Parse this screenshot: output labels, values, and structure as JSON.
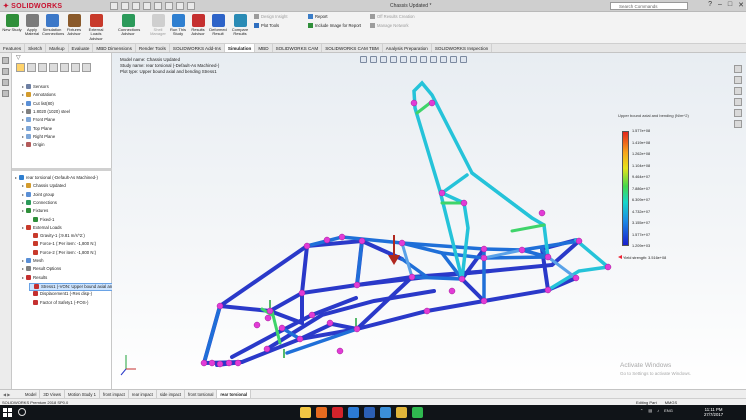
{
  "app": {
    "brand": "SOLIDWORKS",
    "document_title": "Chassis Updated *",
    "search_placeholder": "Search Commands"
  },
  "ribbon": {
    "big_buttons": [
      {
        "label": "New Study",
        "color": "#2f8f3a",
        "dim": false
      },
      {
        "label": "Apply Material",
        "color": "#7b7b7b",
        "dim": false
      },
      {
        "label": "Simulation Connections",
        "color": "#3c78c8",
        "dim": false
      },
      {
        "label": "Fixtures Advisor",
        "color": "#8a5a2b",
        "dim": false
      },
      {
        "label": "External Loads Advisor",
        "color": "#c83a2b",
        "dim": false
      },
      {
        "label": "Connections Advisor",
        "color": "#2b9a5a",
        "dim": false
      },
      {
        "label": "Shell Manager",
        "color": "#7b7b7b",
        "dim": true
      },
      {
        "label": "Run This Study",
        "color": "#2f7fd0",
        "dim": false
      },
      {
        "label": "Results Advisor",
        "color": "#c53030",
        "dim": false
      },
      {
        "label": "Deformed Result",
        "color": "#2d63c8",
        "dim": false
      },
      {
        "label": "Compare Results",
        "color": "#2a8bb5",
        "dim": false
      }
    ],
    "small_buttons": [
      {
        "label": "Design Insight",
        "color": "#9c9c9c",
        "dim": true
      },
      {
        "label": "Plot Tools",
        "color": "#2f6fc0",
        "dim": false
      },
      {
        "label": "Report",
        "color": "#3c7ec8",
        "dim": false
      },
      {
        "label": "Include Image for Report",
        "color": "#2f8f3a",
        "dim": false
      },
      {
        "label": "Off Results Creation",
        "color": "#9c9c9c",
        "dim": true
      },
      {
        "label": "Manage Network",
        "color": "#9c9c9c",
        "dim": true
      }
    ]
  },
  "tabs": [
    {
      "label": "Features",
      "active": false
    },
    {
      "label": "Sketch",
      "active": false
    },
    {
      "label": "Markup",
      "active": false
    },
    {
      "label": "Evaluate",
      "active": false
    },
    {
      "label": "MBD Dimensions",
      "active": false
    },
    {
      "label": "Render Tools",
      "active": false
    },
    {
      "label": "SOLIDWORKS Add-Ins",
      "active": false
    },
    {
      "label": "Simulation",
      "active": true
    },
    {
      "label": "MBD",
      "active": false
    },
    {
      "label": "SOLIDWORKS CAM",
      "active": false
    },
    {
      "label": "SOLIDWORKS CAM TBM",
      "active": false
    },
    {
      "label": "Analysis Preparation",
      "active": false
    },
    {
      "label": "SOLIDWORKS Inspection",
      "active": false
    }
  ],
  "tree": {
    "upper": [
      {
        "label": "Sensors",
        "icon_color": "#6d7fa3",
        "indent": 1
      },
      {
        "label": "Annotations",
        "icon_color": "#d39b2c",
        "indent": 1
      },
      {
        "label": "Cut list(80)",
        "icon_color": "#5a8fd6",
        "indent": 1
      },
      {
        "label": "1.8020 (1020) steel",
        "icon_color": "#7f7f7f",
        "indent": 1
      },
      {
        "label": "Front Plane",
        "icon_color": "#7da6d8",
        "indent": 1
      },
      {
        "label": "Top Plane",
        "icon_color": "#7da6d8",
        "indent": 1
      },
      {
        "label": "Right Plane",
        "icon_color": "#7da6d8",
        "indent": 1
      },
      {
        "label": "Origin",
        "icon_color": "#b35a5a",
        "indent": 1
      }
    ],
    "lower": [
      {
        "label": "rear torsional (-Default-As Machined-)",
        "icon_color": "#2f7fd0",
        "indent": 0,
        "selected": false
      },
      {
        "label": "Chassis Updated",
        "icon_color": "#d39b2c",
        "indent": 1,
        "selected": false
      },
      {
        "label": "Joint group",
        "icon_color": "#5a8fd6",
        "indent": 1,
        "selected": false
      },
      {
        "label": "Connections",
        "icon_color": "#2b9a5a",
        "indent": 1,
        "selected": false
      },
      {
        "label": "Fixtures",
        "icon_color": "#2f8f3a",
        "indent": 1,
        "selected": false
      },
      {
        "label": "Fixed-1",
        "icon_color": "#2f8f3a",
        "indent": 2,
        "selected": false
      },
      {
        "label": "External Loads",
        "icon_color": "#c83a2b",
        "indent": 1,
        "selected": false
      },
      {
        "label": "Gravity-1 (:9.81 m/s^2:)",
        "icon_color": "#c83a2b",
        "indent": 2,
        "selected": false
      },
      {
        "label": "Force-1 (:Per item: -1,800 N:)",
        "icon_color": "#c83a2b",
        "indent": 2,
        "selected": false
      },
      {
        "label": "Force-2 (:Per item: -1,800 N:)",
        "icon_color": "#c83a2b",
        "indent": 2,
        "selected": false
      },
      {
        "label": "Mesh",
        "icon_color": "#5a8fd6",
        "indent": 1,
        "selected": false
      },
      {
        "label": "Result Options",
        "icon_color": "#7f7f7f",
        "indent": 1,
        "selected": false
      },
      {
        "label": "Results",
        "icon_color": "#c53030",
        "indent": 1,
        "selected": false
      },
      {
        "label": "Stress1 (-VON: Upper bound axial and bending-)",
        "icon_color": "#c53030",
        "indent": 2,
        "selected": true
      },
      {
        "label": "Displacement1 (-Res disp-)",
        "icon_color": "#c53030",
        "indent": 2,
        "selected": false
      },
      {
        "label": "Factor of Safety1 (-FOS-)",
        "icon_color": "#c53030",
        "indent": 2,
        "selected": false
      }
    ]
  },
  "graphics": {
    "info_lines": [
      "Model name: Chassis Updated",
      "Study name: rear torsional (-Default-As Machined-)",
      "Plot type: Upper bound axial and bending Stress1"
    ],
    "legend_title": "Upper bound axial and bending (N/m^2)",
    "legend_ticks": [
      "1.577e+08",
      "1.419e+08",
      "1.262e+08",
      "1.104e+08",
      "9.464e+07",
      "7.886e+07",
      "6.309e+07",
      "4.732e+07",
      "3.155e+07",
      "1.577e+07",
      "1.209e+03"
    ],
    "yield_label": "Yield strength: 3.516e+08",
    "watermark": "Activate Windows",
    "watermark_sub": "Go to Settings to activate Windows."
  },
  "bottom_tabs": [
    {
      "label": "Model",
      "active": false
    },
    {
      "label": "3D Views",
      "active": false
    },
    {
      "label": "Motion Study 1",
      "active": false
    },
    {
      "label": "front impact",
      "active": false
    },
    {
      "label": "rear impact",
      "active": false
    },
    {
      "label": "side impact",
      "active": false
    },
    {
      "label": "front torsional",
      "active": false
    },
    {
      "label": "rear torsional",
      "active": true
    }
  ],
  "status": {
    "left": "SOLIDWORKS Premium 2018 SP0.0",
    "right_1": "Editing Part",
    "right_2": "MMGS"
  },
  "taskbar": {
    "apps": [
      {
        "name": "explorer-app",
        "color": "#f2c744"
      },
      {
        "name": "firefox-app",
        "color": "#e66b1f"
      },
      {
        "name": "solidworks-app",
        "color": "#d4232b"
      },
      {
        "name": "edge-app",
        "color": "#2b7bd6"
      },
      {
        "name": "word-app",
        "color": "#2b5fb5"
      },
      {
        "name": "store-app",
        "color": "#3b8fd8"
      },
      {
        "name": "chrome-app",
        "color": "#e0b53a"
      },
      {
        "name": "whatsapp-app",
        "color": "#2fb84f"
      }
    ],
    "tray_lang": "ENG",
    "time": "11:11 PM",
    "date": "27/7/2017"
  }
}
